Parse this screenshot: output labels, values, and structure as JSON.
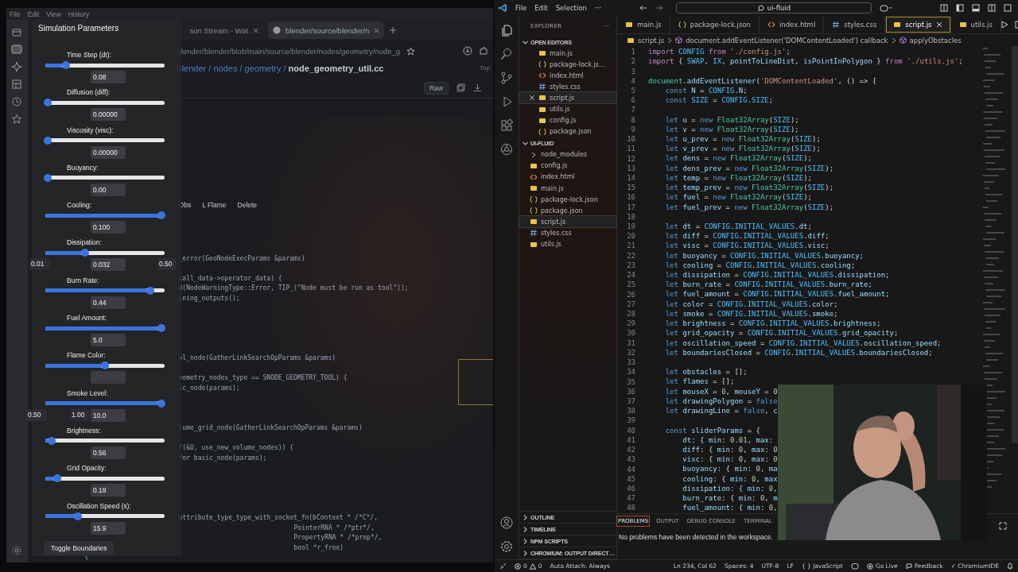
{
  "browser": {
    "menu": [
      "File",
      "Edit",
      "View",
      "History"
    ],
    "tabs": [
      {
        "title": "son Stream - Wat",
        "selected": false
      },
      {
        "title": "blender/source/blender/n",
        "selected": true
      }
    ],
    "url": "blender/blender/blob/main/source/blender/nodes/geometry/node_g",
    "breadcrumb": "blender / nodes / geometry / **node_geometry_util.cc**",
    "top_link": "Top",
    "raw_button": "Raw",
    "code_lines": [
      {
        "kind": "fragment",
        "text": "_error(GeoNodeExecParams &params)"
      },
      {
        "kind": "fragment",
        "text": "call_data->operator_data) {"
      },
      {
        "kind": "fragment",
        "text": "d(NodeWarningType::Error, TIP_(\"Node must be run as tool\"));"
      },
      {
        "kind": "fragment",
        "text": "ining_outputs();"
      },
      {
        "kind": "fragment",
        "text": "ol_node(GatherLinkSearchOpParams &params)"
      },
      {
        "kind": "fragment",
        "text": "eometry_nodes_type == SNODE_GEOMETRY_TOOL) {"
      },
      {
        "kind": "fragment",
        "text": "ic_node(params);"
      },
      {
        "kind": "fragment",
        "text": "lume_grid_node(GatherLinkSearchOpParams &params)"
      },
      {
        "kind": "fragment",
        "text": "f(&U, use_new_volume_nodes)) {"
      },
      {
        "kind": "fragment",
        "text": "for basic_node(params);"
      },
      {
        "kind": "fragment",
        "text": "attribute_type_type_with_socket_fn(bContext * /*C*/,"
      },
      {
        "kind": "continuation",
        "text": "PointerRNA * /*ptr*/,"
      },
      {
        "kind": "continuation",
        "text": "PropertyRNA * /*prop*/,"
      },
      {
        "kind": "continuation",
        "text": "bool *r_free)"
      },
      {
        "kind": "plain",
        "text": "{"
      }
    ],
    "canvas_buttons": [
      "Obs",
      "L Flame",
      "Delete"
    ]
  },
  "panel": {
    "title": "Simulation Parameters",
    "sliders": [
      {
        "label": "Time Step (dt):",
        "level": 0.17,
        "value": "0.08"
      },
      {
        "label": "Diffusion (diff):",
        "level": 0.02,
        "value": "0.00000"
      },
      {
        "label": "Viscosity (visc):",
        "level": 0.02,
        "value": "0.00000"
      },
      {
        "label": "Buoyancy:",
        "level": 0.02,
        "value": "0.00"
      },
      {
        "label": "Cooling:",
        "level": 0.97,
        "value": "0.100"
      },
      {
        "label": "Dissipation:",
        "level": 0.33,
        "value": "0.032"
      },
      {
        "label": "Burn Rate:",
        "level": 0.88,
        "value": "0.44"
      },
      {
        "label": "Fuel Amount:",
        "level": 0.97,
        "value": "5.0"
      },
      {
        "label": "Flame Color:",
        "level": 0.5
      },
      {
        "label": "Smoke Level:",
        "level": 0.97,
        "value": "10.0"
      },
      {
        "label": "Brightness:",
        "level": 0.05,
        "value": "0.56"
      },
      {
        "label": "Grid Opacity:",
        "level": 0.1,
        "value": "0.19"
      },
      {
        "label": "Oscillation Speed (s):",
        "level": 0.27,
        "value": "15.9"
      }
    ],
    "range_labels": [
      {
        "min": "0.01",
        "max": "0.50"
      },
      {
        "min": "0.50",
        "max": "1.00"
      }
    ],
    "toggle_button": "Toggle Boundaries"
  },
  "editor": {
    "menu": [
      "File",
      "Edit",
      "Selection",
      "···"
    ],
    "search": "ui-fluid",
    "explorer": {
      "title": "EXPLORER",
      "more": "···",
      "sections": [
        {
          "title": "OPEN EDITORS",
          "expanded": true,
          "items": [
            {
              "name": "main.js",
              "kind": "js",
              "selected": false
            },
            {
              "name": "package-lock.js…",
              "kind": "json",
              "selected": false
            },
            {
              "name": "index.html",
              "kind": "html",
              "selected": false
            },
            {
              "name": "styles.css",
              "kind": "css",
              "selected": false
            },
            {
              "name": "script.js",
              "kind": "js",
              "selected": true
            },
            {
              "name": "utils.js",
              "kind": "js",
              "selected": false
            },
            {
              "name": "config.js",
              "kind": "js",
              "selected": false
            },
            {
              "name": "package.json",
              "kind": "json",
              "selected": false
            }
          ]
        },
        {
          "title": "UI-FLUID",
          "expanded": true,
          "items": [
            {
              "name": "node_modules",
              "kind": "folder",
              "selected": false
            },
            {
              "name": "config.js",
              "kind": "js",
              "selected": false
            },
            {
              "name": "index.html",
              "kind": "html",
              "selected": false
            },
            {
              "name": "main.js",
              "kind": "js",
              "selected": false
            },
            {
              "name": "package-lock.json",
              "kind": "json",
              "selected": false
            },
            {
              "name": "package.json",
              "kind": "json",
              "selected": false
            },
            {
              "name": "script.js",
              "kind": "js",
              "selected": true
            },
            {
              "name": "styles.css",
              "kind": "css",
              "selected": false
            },
            {
              "name": "utils.js",
              "kind": "js",
              "selected": false
            }
          ]
        }
      ],
      "bottom_sections": [
        {
          "title": "OUTLINE",
          "expanded": false
        },
        {
          "title": "TIMELINE",
          "expanded": false
        },
        {
          "title": "NPM SCRIPTS",
          "expanded": false
        },
        {
          "title": "CHROMIUM: OUTPUT DIRECT…",
          "expanded": false
        }
      ]
    },
    "tabs": [
      {
        "name": "main.js",
        "kind": "js",
        "selected": false
      },
      {
        "name": "package-lock.json",
        "kind": "json",
        "selected": false
      },
      {
        "name": "index.html",
        "kind": "html",
        "selected": false
      },
      {
        "name": "styles.css",
        "kind": "css",
        "selected": false
      },
      {
        "name": "script.js",
        "kind": "js",
        "selected": true
      },
      {
        "name": "utils.js",
        "kind": "js",
        "selected": false
      }
    ],
    "breadcrumb": [
      "script.js",
      "document.addEventListener('DOMContentLoaded') callback",
      "applyObstacles"
    ],
    "lines": [
      {
        "number": "1",
        "text": "import CONFIG from './config.js';"
      },
      {
        "number": "2",
        "text": "import { SWAP, IX, pointToLineDist, isPointInPolygon } from './utils.js';"
      },
      {
        "number": "3"
      },
      {
        "number": "4",
        "text": "document.addEventListener('DOMContentLoaded', () => {"
      },
      {
        "number": "5",
        "text": "    const N = CONFIG.N;"
      },
      {
        "number": "6",
        "text": "    const SIZE = CONFIG.SIZE;"
      },
      {
        "number": "7"
      },
      {
        "number": "8",
        "text": "    let u = new Float32Array(SIZE);"
      },
      {
        "number": "9",
        "text": "    let v = new Float32Array(SIZE);"
      },
      {
        "number": "10",
        "text": "    let u_prev = new Float32Array(SIZE);"
      },
      {
        "number": "11",
        "text": "    let v_prev = new Float32Array(SIZE);"
      },
      {
        "number": "12",
        "text": "    let dens = new Float32Array(SIZE);"
      },
      {
        "number": "13",
        "text": "    let dens_prev = new Float32Array(SIZE);"
      },
      {
        "number": "14",
        "text": "    let temp = new Float32Array(SIZE);"
      },
      {
        "number": "15",
        "text": "    let temp_prev = new Float32Array(SIZE);"
      },
      {
        "number": "16",
        "text": "    let fuel = new Float32Array(SIZE);"
      },
      {
        "number": "17",
        "text": "    let fuel_prev = new Float32Array(SIZE);"
      },
      {
        "number": "18"
      },
      {
        "number": "19",
        "text": "    let dt = CONFIG.INITIAL_VALUES.dt;"
      },
      {
        "number": "20",
        "text": "    let diff = CONFIG.INITIAL_VALUES.diff;"
      },
      {
        "number": "21",
        "text": "    let visc = CONFIG.INITIAL_VALUES.visc;"
      },
      {
        "number": "22",
        "text": "    let buoyancy = CONFIG.INITIAL_VALUES.buoyancy;"
      },
      {
        "number": "23",
        "text": "    let cooling = CONFIG.INITIAL_VALUES.cooling;"
      },
      {
        "number": "24",
        "text": "    let dissipation = CONFIG.INITIAL_VALUES.dissipation;"
      },
      {
        "number": "25",
        "text": "    let burn_rate = CONFIG.INITIAL_VALUES.burn_rate;"
      },
      {
        "number": "26",
        "text": "    let fuel_amount = CONFIG.INITIAL_VALUES.fuel_amount;"
      },
      {
        "number": "27",
        "text": "    let color = CONFIG.INITIAL_VALUES.color;"
      },
      {
        "number": "28",
        "text": "    let smoke = CONFIG.INITIAL_VALUES.smoke;"
      },
      {
        "number": "29",
        "text": "    let brightness = CONFIG.INITIAL_VALUES.brightness;"
      },
      {
        "number": "30",
        "text": "    let grid_opacity = CONFIG.INITIAL_VALUES.grid_opacity;"
      },
      {
        "number": "31",
        "text": "    let oscillation_speed = CONFIG.INITIAL_VALUES.oscillation_speed;"
      },
      {
        "number": "32",
        "text": "    let boundariesClosed = CONFIG.INITIAL_VALUES.boundariesClosed;"
      },
      {
        "number": "33"
      },
      {
        "number": "34",
        "text": "    let obstacles = [];"
      },
      {
        "number": "35",
        "text": "    let flames = [];"
      },
      {
        "number": "36",
        "text": "    let mouseX = 0, mouseY = 0"
      },
      {
        "number": "37",
        "text": "    let drawingPolygon = false"
      },
      {
        "number": "38",
        "text": "    let drawingLine = false, c"
      },
      {
        "number": "39"
      },
      {
        "number": "40",
        "text": "    const sliderParams = {"
      },
      {
        "number": "41",
        "text": "        dt: { min: 0.01, max:"
      },
      {
        "number": "42",
        "text": "        diff: { min: 0, max: 0"
      },
      {
        "number": "43",
        "text": "        visc: { min: 0, max: 0"
      },
      {
        "number": "44",
        "text": "        buoyancy: { min: 0, ma"
      },
      {
        "number": "45",
        "text": "        cooling: { min: 0, max"
      },
      {
        "number": "46",
        "text": "        dissipation: { min: 0,"
      },
      {
        "number": "47",
        "text": "        burn_rate: { min: 0, m"
      },
      {
        "number": "48",
        "text": "        fuel_amount: { min: 0,"
      }
    ],
    "panel_tabs": [
      {
        "label": "PROBLEMS",
        "selected": true
      },
      {
        "label": "OUTPUT",
        "selected": false
      },
      {
        "label": "DEBUG CONSOLE",
        "selected": false
      },
      {
        "label": "TERMINAL",
        "selected": false
      }
    ],
    "panel_message": "No problems have been detected in the workspace.",
    "status": {
      "errors": "0",
      "warnings": "0",
      "auto_attach": "Auto Attach: Always",
      "position": "Ln 234, Col 62",
      "spaces": "Spaces: 4",
      "encoding": "UTF-8",
      "eol": "LF",
      "language": "{ } JavaScript",
      "go_live": "Go Live",
      "feedback": "Feedback",
      "extension": "✓ ChromiumIDE"
    }
  }
}
